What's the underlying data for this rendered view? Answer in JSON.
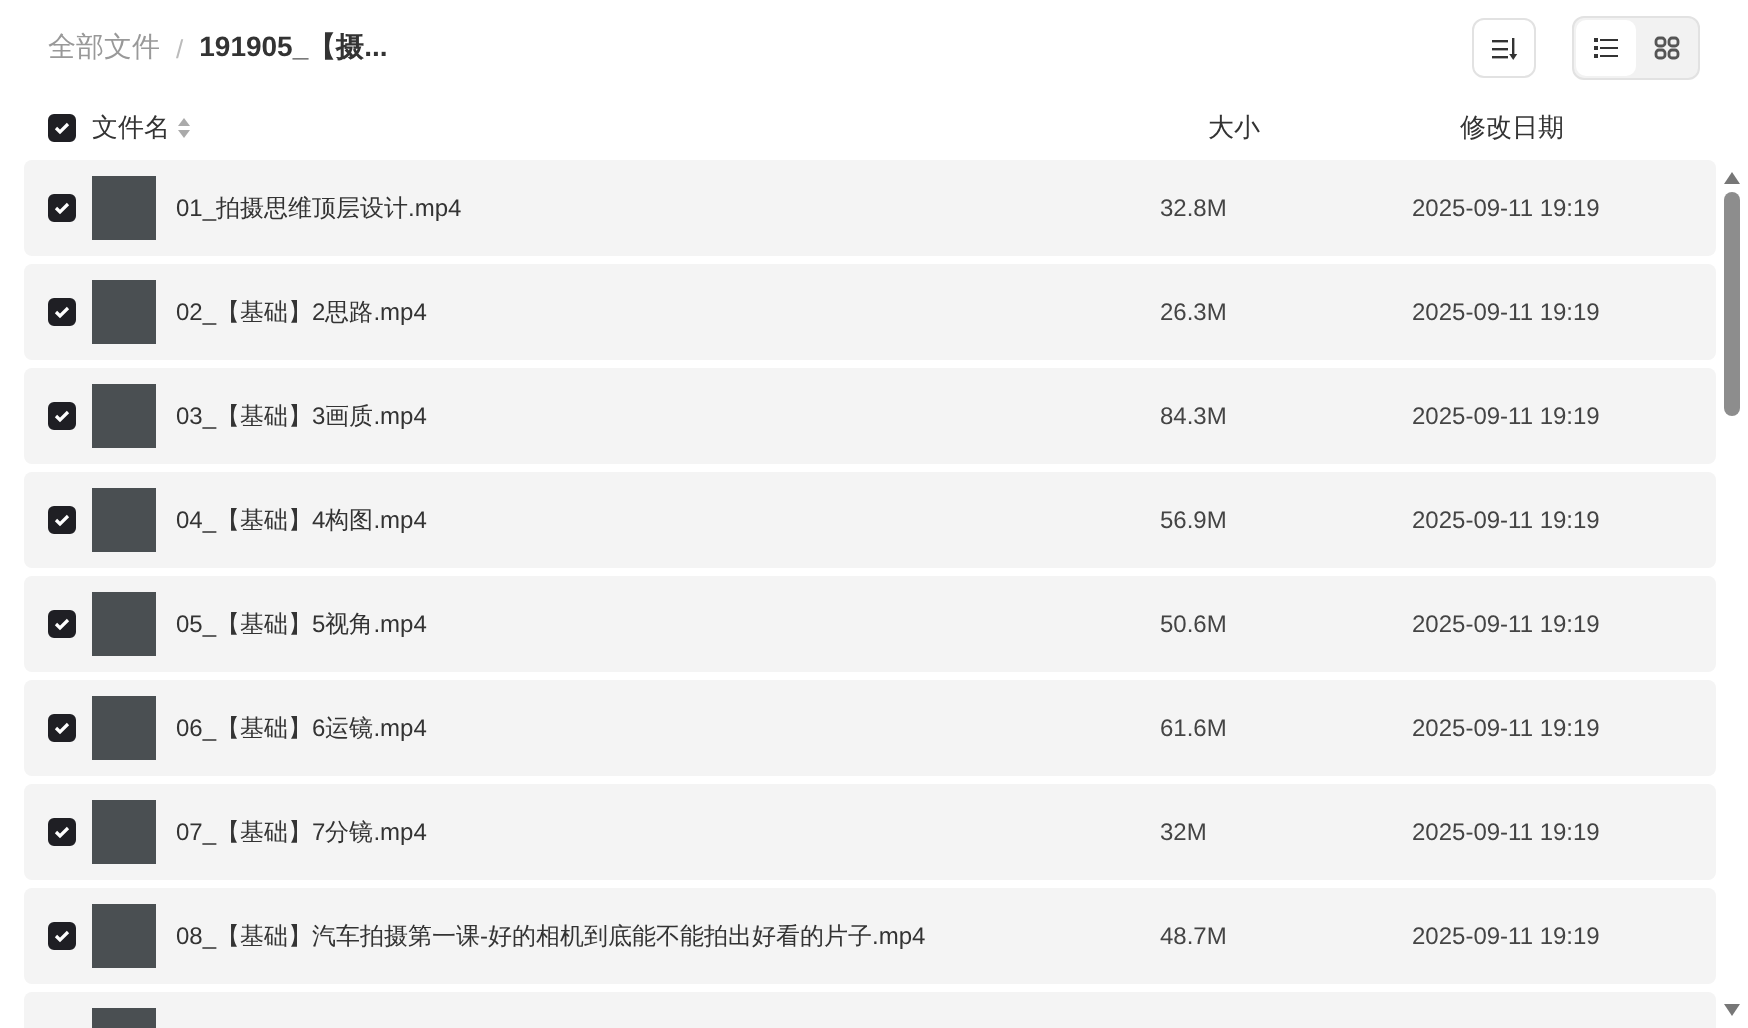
{
  "breadcrumb": [
    {
      "label": "全部文件",
      "current": false
    },
    {
      "label": "191905_【摄...",
      "current": true
    }
  ],
  "breadcrumb_separator": "/",
  "view_modes": [
    {
      "kind": "list",
      "selected": true
    },
    {
      "kind": "grid",
      "selected": false
    }
  ],
  "table": {
    "select_all": {
      "checked": true
    },
    "columns": [
      "文件名",
      "大小",
      "修改日期"
    ],
    "rows": [
      {
        "checked": true,
        "name": "01_拍摄思维顶层设计.mp4",
        "size": "32.8M",
        "date": "2025-09-11 19:19"
      },
      {
        "checked": true,
        "name": "02_【基础】2思路.mp4",
        "size": "26.3M",
        "date": "2025-09-11 19:19"
      },
      {
        "checked": true,
        "name": "03_【基础】3画质.mp4",
        "size": "84.3M",
        "date": "2025-09-11 19:19"
      },
      {
        "checked": true,
        "name": "04_【基础】4构图.mp4",
        "size": "56.9M",
        "date": "2025-09-11 19:19"
      },
      {
        "checked": true,
        "name": "05_【基础】5视角.mp4",
        "size": "50.6M",
        "date": "2025-09-11 19:19"
      },
      {
        "checked": true,
        "name": "06_【基础】6运镜.mp4",
        "size": "61.6M",
        "date": "2025-09-11 19:19"
      },
      {
        "checked": true,
        "name": "07_【基础】7分镜.mp4",
        "size": "32M",
        "date": "2025-09-11 19:19"
      },
      {
        "checked": true,
        "name": "08_【基础】汽车拍摄第一课-好的相机到底能不能拍出好看的片子.mp4",
        "size": "48.7M",
        "date": "2025-09-11 19:19"
      }
    ]
  }
}
